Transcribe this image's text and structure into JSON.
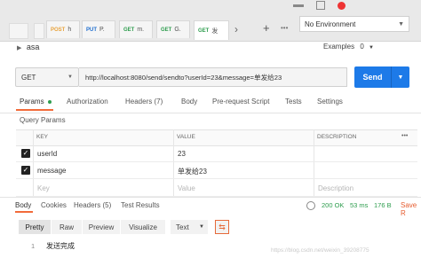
{
  "tabs": [
    {
      "method": "POST",
      "name": "h",
      "modified": true,
      "method_color": "#e8a33d"
    },
    {
      "method": "PUT",
      "name": "P.",
      "modified": false,
      "method_color": "#1f6ecf"
    },
    {
      "method": "GET",
      "name": "m.",
      "modified": false,
      "method_color": "#2e9d4e"
    },
    {
      "method": "GET",
      "name": "G.",
      "modified": false,
      "method_color": "#2e9d4e"
    },
    {
      "method": "GET",
      "name": "发",
      "modified": false,
      "method_color": "#2e9d4e"
    }
  ],
  "tab_controls": {
    "more": "›",
    "add": "+",
    "overflow": "•••"
  },
  "environment": {
    "selected": "No Environment"
  },
  "request": {
    "name": "asa",
    "examples_label": "Examples",
    "examples_count": "0",
    "method": "GET",
    "url": "http://localhost:8080/send/sendto?userId=23&message=单发给23",
    "send_label": "Send"
  },
  "request_tabs": [
    "Params",
    "Authorization",
    "Headers (7)",
    "Body",
    "Pre-request Script",
    "Tests",
    "Settings"
  ],
  "query_params_label": "Query Params",
  "params_table": {
    "headers": [
      "KEY",
      "VALUE",
      "DESCRIPTION"
    ],
    "more": "•••",
    "rows": [
      {
        "key": "userId",
        "value": "23",
        "description": "",
        "checked": true
      },
      {
        "key": "message",
        "value": "单发给23",
        "description": "",
        "checked": true
      }
    ],
    "placeholder": {
      "key": "Key",
      "value": "Value",
      "description": "Description"
    }
  },
  "response": {
    "tabs": [
      "Body",
      "Cookies",
      "Headers (5)",
      "Test Results"
    ],
    "status": "200 OK",
    "time": "53 ms",
    "size": "176 B",
    "save_label": "Save R",
    "formats": [
      "Pretty",
      "Raw",
      "Preview",
      "Visualize"
    ],
    "format_type": "Text",
    "line_number": "1",
    "body_text": "发送完成",
    "watermark": "https://blog.csdn.net/weixin_39208775"
  },
  "colors": {
    "accent": "#f26b3a",
    "send": "#1d7ae8",
    "status_ok": "#2e9d4e"
  }
}
